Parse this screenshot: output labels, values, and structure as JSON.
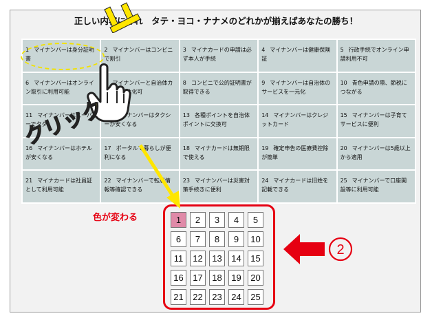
{
  "title": "正しい内容にそれ　タテ・ヨコ・ナナメのどれかが揃えばあなたの勝ち！",
  "cells": [
    {
      "num": "1",
      "text": "マイナンバーは身分証明書"
    },
    {
      "num": "2",
      "text": "マイナンバーはコンビニで割引"
    },
    {
      "num": "3",
      "text": "マイナカードの申請は必ず本人が手続"
    },
    {
      "num": "4",
      "text": "マイナンバーは健康保険証"
    },
    {
      "num": "5",
      "text": "行政手続でオンライン申請利用不可"
    },
    {
      "num": "6",
      "text": "マイナンバーはオンライン取引に利用可能"
    },
    {
      "num": "7",
      "text": "マイナンバーと自治体カードは一体化可"
    },
    {
      "num": "8",
      "text": "コンビニで公的証明書が取得できる"
    },
    {
      "num": "9",
      "text": "マイナンバーは自治体のサービスを一元化"
    },
    {
      "num": "10",
      "text": "青色申請の際、節税につながる"
    },
    {
      "num": "11",
      "text": "マイナンバーはスーパーでタダ"
    },
    {
      "num": "12",
      "text": "マイナンバーはタクシーが安くなる"
    },
    {
      "num": "13",
      "text": "各種ポイントを自治体ポイントに交換可"
    },
    {
      "num": "14",
      "text": "マイナンバーはクレジットカード"
    },
    {
      "num": "15",
      "text": "マイナンバーは子育てサービスに便利"
    },
    {
      "num": "16",
      "text": "マイナンバーはホテルが安くなる"
    },
    {
      "num": "17",
      "text": "ポータルで暮らしが便利になる"
    },
    {
      "num": "18",
      "text": "マイナカードは無期限で使える"
    },
    {
      "num": "19",
      "text": "確定申告の医療費控除が簡単"
    },
    {
      "num": "20",
      "text": "マイナンバーは5歳以上から適用"
    },
    {
      "num": "21",
      "text": "マイナカードは社員証として利用可能"
    },
    {
      "num": "22",
      "text": "マイナンバーで転居情報等確認できる"
    },
    {
      "num": "23",
      "text": "マイナンバーは災害対策手続きに便利"
    },
    {
      "num": "24",
      "text": "マイナカードは旧姓を記載できる"
    },
    {
      "num": "25",
      "text": "マイナンバーで口座開設等に利用可能"
    }
  ],
  "picker": [
    "1",
    "2",
    "3",
    "4",
    "5",
    "6",
    "7",
    "8",
    "9",
    "10",
    "11",
    "12",
    "13",
    "14",
    "15",
    "16",
    "17",
    "18",
    "19",
    "20",
    "21",
    "22",
    "23",
    "24",
    "25"
  ],
  "picker_selected": "1",
  "annotations": {
    "color_changes": "色が変わる",
    "click": "クリック",
    "step_number": "②"
  },
  "colors": {
    "cell_bg": "#c9d6d6",
    "selected_bg": "#e08aa8",
    "accent_red": "#e60012",
    "annotation_yellow": "#ffe600"
  }
}
